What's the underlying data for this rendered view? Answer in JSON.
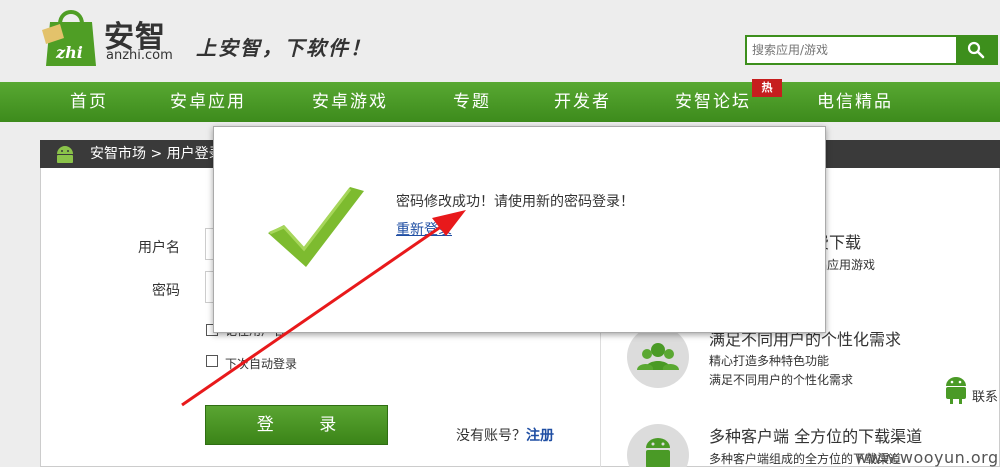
{
  "header": {
    "logo_name": "安智",
    "logo_domain": "anzhi.com",
    "logo_bag_text": "zhi",
    "slogan": "上安智，下软件！",
    "search_placeholder": "搜索应用/游戏"
  },
  "nav": {
    "items": [
      "首页",
      "安卓应用",
      "安卓游戏",
      "专题",
      "开发者",
      "安智论坛",
      "电信精品"
    ],
    "hot_badge": "热"
  },
  "breadcrumb": "安智市场 > 用户登录",
  "form": {
    "username_label": "用户名",
    "password_label": "密码",
    "remember_label": "记住用户名",
    "autologin_label": "下次自动登录",
    "login_button": "登 录",
    "no_account": "没有账号？",
    "register": "注册"
  },
  "features": [
    {
      "title": "免费下载",
      "desc": "精品应用游戏"
    },
    {
      "title": "满足不同用户的个性化需求",
      "desc1": "精心打造多种特色功能",
      "desc2": "满足不同用户的个性化需求"
    },
    {
      "title": "多种客户端   全方位的下载渠道",
      "desc": "多种客户端组成的全方位的下载渠道"
    }
  ],
  "contact_label": "联系",
  "watermark": "www.wooyun.org",
  "modal": {
    "message": "密码修改成功！请使用新的密码登录！",
    "relogin_link": "重新登录"
  },
  "colors": {
    "brand_green": "#3d8f1c",
    "nav_green": "#4a9a26",
    "check_green": "#7dbb2f",
    "link_blue": "#1f4ea3",
    "arrow_red": "#e8191b"
  }
}
